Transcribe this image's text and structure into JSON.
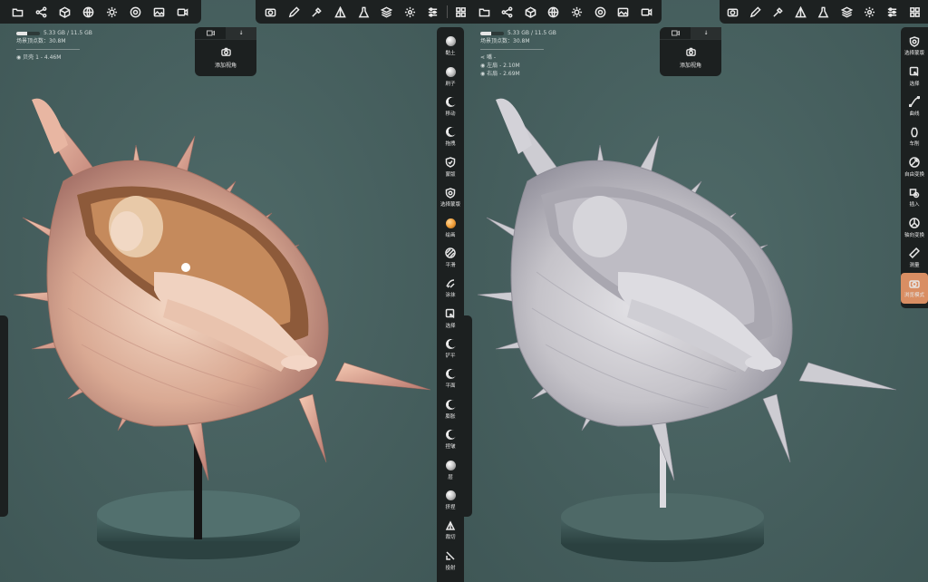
{
  "left_view": {
    "memory": "5.33 GB / 11.5 GB",
    "memory_used_fraction": 0.46,
    "vertices": "场景顶点数：30.8M",
    "object": "贝壳 1 - 4.46M",
    "camera_popup": {
      "tab1_icon": "video-icon",
      "tab2_icon": "download-icon",
      "action": "添加视角"
    }
  },
  "right_view": {
    "memory": "5.33 GB / 11.5 GB",
    "memory_used_fraction": 0.46,
    "vertices": "场景顶点数：30.8M",
    "group": "嘴",
    "group_suffix": "-",
    "child1": "左扇 - 2.10M",
    "child2": "右扇 - 2.69M",
    "camera_popup": {
      "tab1_icon": "video-icon",
      "tab2_icon": "download-icon",
      "action": "添加视角"
    }
  },
  "toolbar_icons": [
    "camera-icon",
    "pen-icon",
    "pipette-icon",
    "triangle-icon",
    "flask-icon",
    "layers-icon",
    "gear-icon",
    "sliders-icon",
    "grid-icon",
    "folder-icon",
    "nodes-icon",
    "cube-icon",
    "globe-icon",
    "sun-icon",
    "settings-icon",
    "image-icon",
    "video-icon"
  ],
  "sculpt_tools": [
    {
      "label": "黏土",
      "icon": "sphere"
    },
    {
      "label": "刷子",
      "icon": "sphere"
    },
    {
      "label": "移动",
      "icon": "moon"
    },
    {
      "label": "拖拽",
      "icon": "moon"
    },
    {
      "label": "蒙版",
      "icon": "shield"
    },
    {
      "label": "选择蒙版",
      "icon": "shield-select"
    },
    {
      "label": "绘画",
      "icon": "orange"
    },
    {
      "label": "平滑",
      "icon": "hatch"
    },
    {
      "label": "涂抹",
      "icon": "smudge"
    },
    {
      "label": "选择",
      "icon": "select"
    },
    {
      "label": "铲平",
      "icon": "moon"
    },
    {
      "label": "平面",
      "icon": "moon"
    },
    {
      "label": "膨胀",
      "icon": "moon"
    },
    {
      "label": "捏皱",
      "icon": "moon"
    },
    {
      "label": "层",
      "icon": "sphere"
    },
    {
      "label": "挤捏",
      "icon": "sphere"
    },
    {
      "label": "裁切",
      "icon": "cut"
    },
    {
      "label": "投射",
      "icon": "project"
    }
  ],
  "right_tools": [
    {
      "label": "选择蒙版",
      "icon": "shield-select"
    },
    {
      "label": "选择",
      "icon": "select"
    },
    {
      "label": "曲线",
      "icon": "curve"
    },
    {
      "label": "车削",
      "icon": "lathe"
    },
    {
      "label": "自由变换",
      "icon": "transform"
    },
    {
      "label": "插入",
      "icon": "insert"
    },
    {
      "label": "轴向变换",
      "icon": "axis"
    },
    {
      "label": "测量",
      "icon": "ruler"
    },
    {
      "label": "浏览模式",
      "icon": "camera"
    }
  ],
  "colors": {
    "accent": "#d98e63",
    "panel": "#1c2020",
    "background": "#455f5e"
  }
}
